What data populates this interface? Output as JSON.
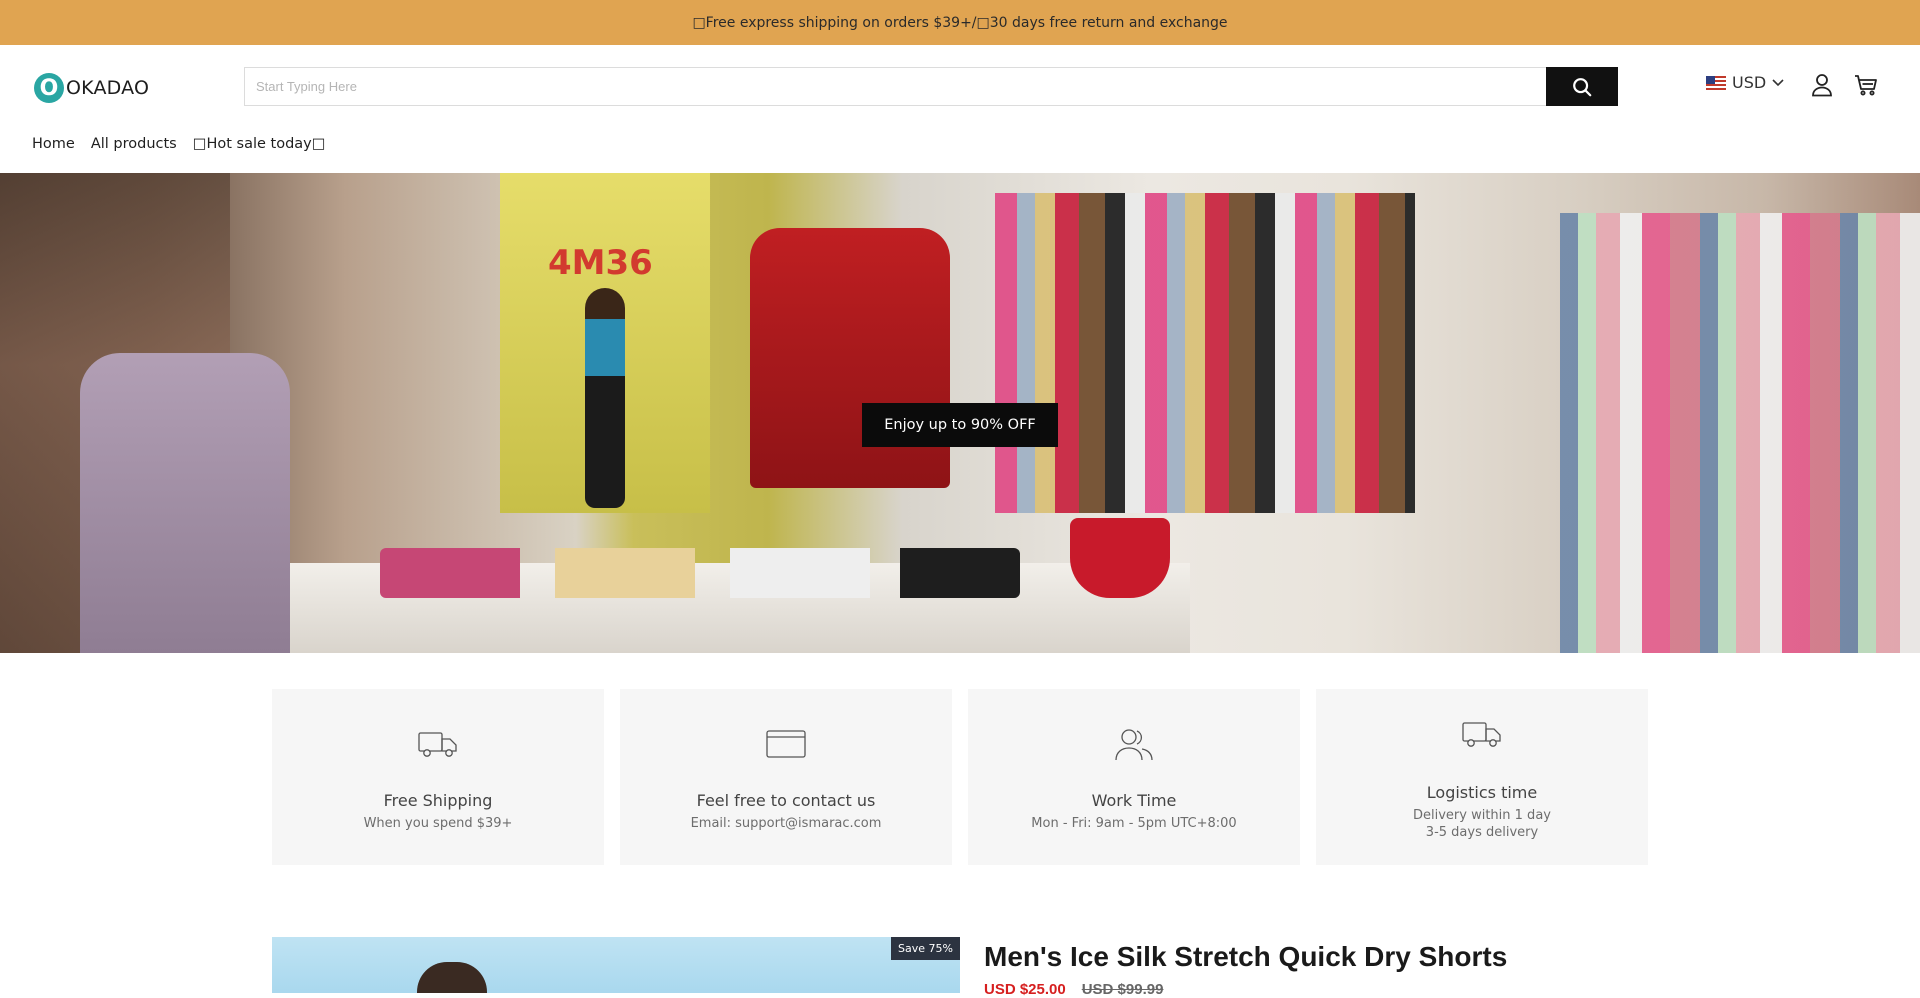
{
  "announcement": "□Free express shipping on orders $39+/□30 days free return and exchange",
  "logo": {
    "mark": "O",
    "text": "OKADAO"
  },
  "search": {
    "placeholder": "Start Typing Here",
    "value": ""
  },
  "icons": {
    "search": "search-icon",
    "account": "user-icon",
    "cart": "cart-icon",
    "chevron": "chevron-down-icon"
  },
  "currency": {
    "label": "USD",
    "flag": "us-flag"
  },
  "nav": [
    {
      "label": "Home"
    },
    {
      "label": "All products"
    },
    {
      "label": "□Hot sale today□"
    }
  ],
  "hero": {
    "cta": "Enjoy up to 90% OFF",
    "poster_text": "4M36"
  },
  "features": [
    {
      "icon": "truck-icon",
      "title": "Free Shipping",
      "subtitle": "When you spend $39+"
    },
    {
      "icon": "envelope-icon",
      "title": "Feel free to contact us",
      "subtitle": "Email: support@ismarac.com"
    },
    {
      "icon": "users-icon",
      "title": "Work Time",
      "subtitle": "Mon - Fri: 9am - 5pm UTC+8:00"
    },
    {
      "icon": "truck-icon",
      "title": "Logistics time",
      "subtitle_line1": "Delivery within 1 day",
      "subtitle_line2": "3-5 days delivery"
    }
  ],
  "product": {
    "badge": "Save 75%",
    "title": "Men's Ice Silk Stretch Quick Dry Shorts",
    "price": "USD $25.00",
    "compare_price": "USD $99.99"
  },
  "colors": {
    "announcement_bg": "#e0a451",
    "button_bg": "#111111",
    "logo_accent": "#2aa6a3",
    "sale_price": "#d61f1f"
  }
}
